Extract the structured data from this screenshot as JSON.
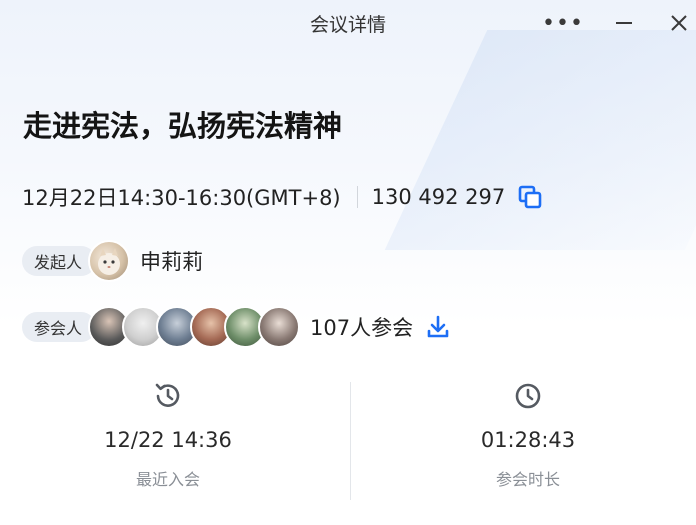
{
  "window": {
    "title": "会议详情",
    "more_label": "•••"
  },
  "meeting": {
    "title": "走进宪法，弘扬宪法精神",
    "time": "12月22日14:30-16:30(GMT+8)",
    "meeting_id": "130 492 297"
  },
  "host": {
    "label": "发起人",
    "name": "申莉莉"
  },
  "attendees": {
    "label": "参会人",
    "count_text": "107人参会",
    "avatar_colors": [
      "#5a5a5a",
      "#cfcfcf",
      "#6f7f93",
      "#a56a55",
      "#6f8f6a",
      "#8a7a74"
    ]
  },
  "stats": {
    "last_join": {
      "value": "12/22 14:36",
      "label": "最近入会"
    },
    "duration": {
      "value": "01:28:43",
      "label": "参会时长"
    }
  },
  "colors": {
    "accent": "#1d6ef5",
    "icon_gray": "#555a61"
  }
}
